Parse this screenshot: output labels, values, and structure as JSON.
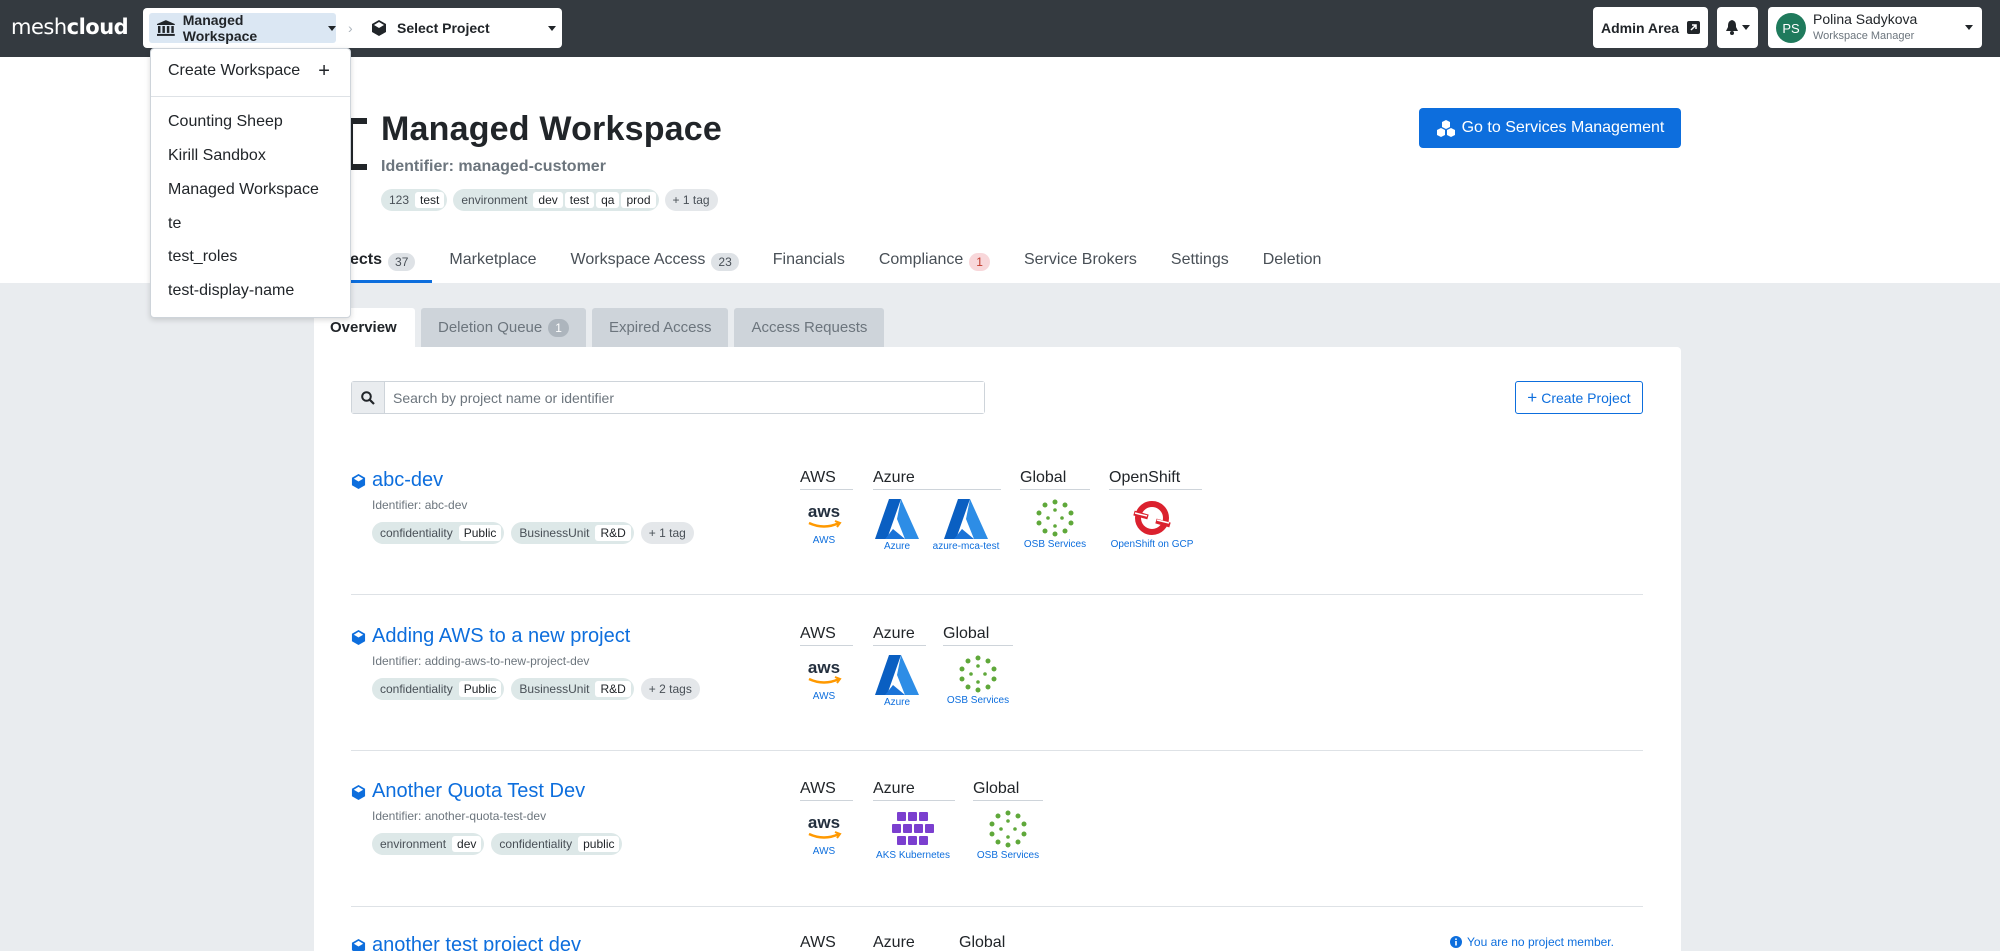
{
  "app": {
    "logo_light": "mesh",
    "logo_bold": "cloud"
  },
  "selector": {
    "workspace_label": "Managed Workspace",
    "project_label": "Select Project"
  },
  "topright": {
    "admin_label": "Admin Area",
    "user_initials": "PS",
    "user_name": "Polina Sadykova",
    "user_role": "Workspace Manager"
  },
  "workspace": {
    "title": "Managed Workspace",
    "identifier": "Identifier: managed-customer",
    "tags": [
      {
        "key": "123",
        "values": [
          "test"
        ]
      },
      {
        "key": "environment",
        "values": [
          "dev",
          "test",
          "qa",
          "prod"
        ]
      }
    ],
    "more_tags": "+ 1 tag",
    "services_button": "Go to Services Management"
  },
  "tabs": [
    {
      "label": "ects",
      "badge": "37"
    },
    {
      "label": "Marketplace",
      "badge": ""
    },
    {
      "label": "Workspace Access",
      "badge": "23"
    },
    {
      "label": "Financials",
      "badge": ""
    },
    {
      "label": "Compliance",
      "badge": "1"
    },
    {
      "label": "Service Brokers",
      "badge": ""
    },
    {
      "label": "Settings",
      "badge": ""
    },
    {
      "label": "Deletion",
      "badge": ""
    }
  ],
  "subtabs": [
    {
      "label": "Overview",
      "badge": ""
    },
    {
      "label": "Deletion Queue",
      "badge": "1"
    },
    {
      "label": "Expired Access",
      "badge": ""
    },
    {
      "label": "Access Requests",
      "badge": ""
    }
  ],
  "search": {
    "placeholder": "Search by project name or identifier"
  },
  "create_project": "Create Project",
  "projects": [
    {
      "name": "abc-dev",
      "identifier": "Identifier: abc-dev",
      "tags": [
        {
          "key": "confidentiality",
          "value": "Public"
        },
        {
          "key": "BusinessUnit",
          "value": "R&D"
        }
      ],
      "more": "+ 1 tag",
      "platforms": [
        {
          "header": "AWS",
          "logos": [
            {
              "icon": "aws-logo",
              "caption": "AWS"
            }
          ]
        },
        {
          "header": "Azure",
          "logos": [
            {
              "icon": "azure-logo",
              "caption": "Azure"
            },
            {
              "icon": "azure-logo",
              "caption": "azure-mca-test"
            }
          ]
        },
        {
          "header": "Global",
          "logos": [
            {
              "icon": "osb-logo",
              "caption": "OSB Services"
            }
          ]
        },
        {
          "header": "OpenShift",
          "logos": [
            {
              "icon": "openshift-logo",
              "caption": "OpenShift on GCP"
            }
          ]
        }
      ]
    },
    {
      "name": "Adding AWS to a new project",
      "identifier": "Identifier: adding-aws-to-new-project-dev",
      "tags": [
        {
          "key": "confidentiality",
          "value": "Public"
        },
        {
          "key": "BusinessUnit",
          "value": "R&D"
        }
      ],
      "more": "+ 2 tags",
      "platforms": [
        {
          "header": "AWS",
          "logos": [
            {
              "icon": "aws-logo",
              "caption": "AWS"
            }
          ]
        },
        {
          "header": "Azure",
          "logos": [
            {
              "icon": "azure-logo",
              "caption": "Azure"
            }
          ]
        },
        {
          "header": "Global",
          "logos": [
            {
              "icon": "osb-logo",
              "caption": "OSB Services"
            }
          ]
        }
      ]
    },
    {
      "name": "Another Quota Test Dev",
      "identifier": "Identifier: another-quota-test-dev",
      "tags": [
        {
          "key": "environment",
          "value": "dev"
        },
        {
          "key": "confidentiality",
          "value": "public"
        }
      ],
      "more": "",
      "platforms": [
        {
          "header": "AWS",
          "logos": [
            {
              "icon": "aws-logo",
              "caption": "AWS"
            }
          ]
        },
        {
          "header": "Azure",
          "logos": [
            {
              "icon": "aks-logo",
              "caption": "AKS Kubernetes"
            }
          ]
        },
        {
          "header": "Global",
          "logos": [
            {
              "icon": "osb-logo",
              "caption": "OSB Services"
            }
          ]
        }
      ]
    },
    {
      "name": "another test project dev",
      "platforms": [
        {
          "header": "AWS"
        },
        {
          "header": "Azure"
        },
        {
          "header": "Global"
        }
      ]
    }
  ],
  "not_member": "You are no project member.",
  "dropdown": {
    "create_label": "Create Workspace",
    "items": [
      "Counting Sheep",
      "Kirill Sandbox",
      "Managed Workspace",
      "te",
      "test_roles",
      "test-display-name"
    ]
  },
  "colors": {
    "primary": "#0d6edd",
    "topbar": "#343a40",
    "background": "#e9ecef"
  }
}
